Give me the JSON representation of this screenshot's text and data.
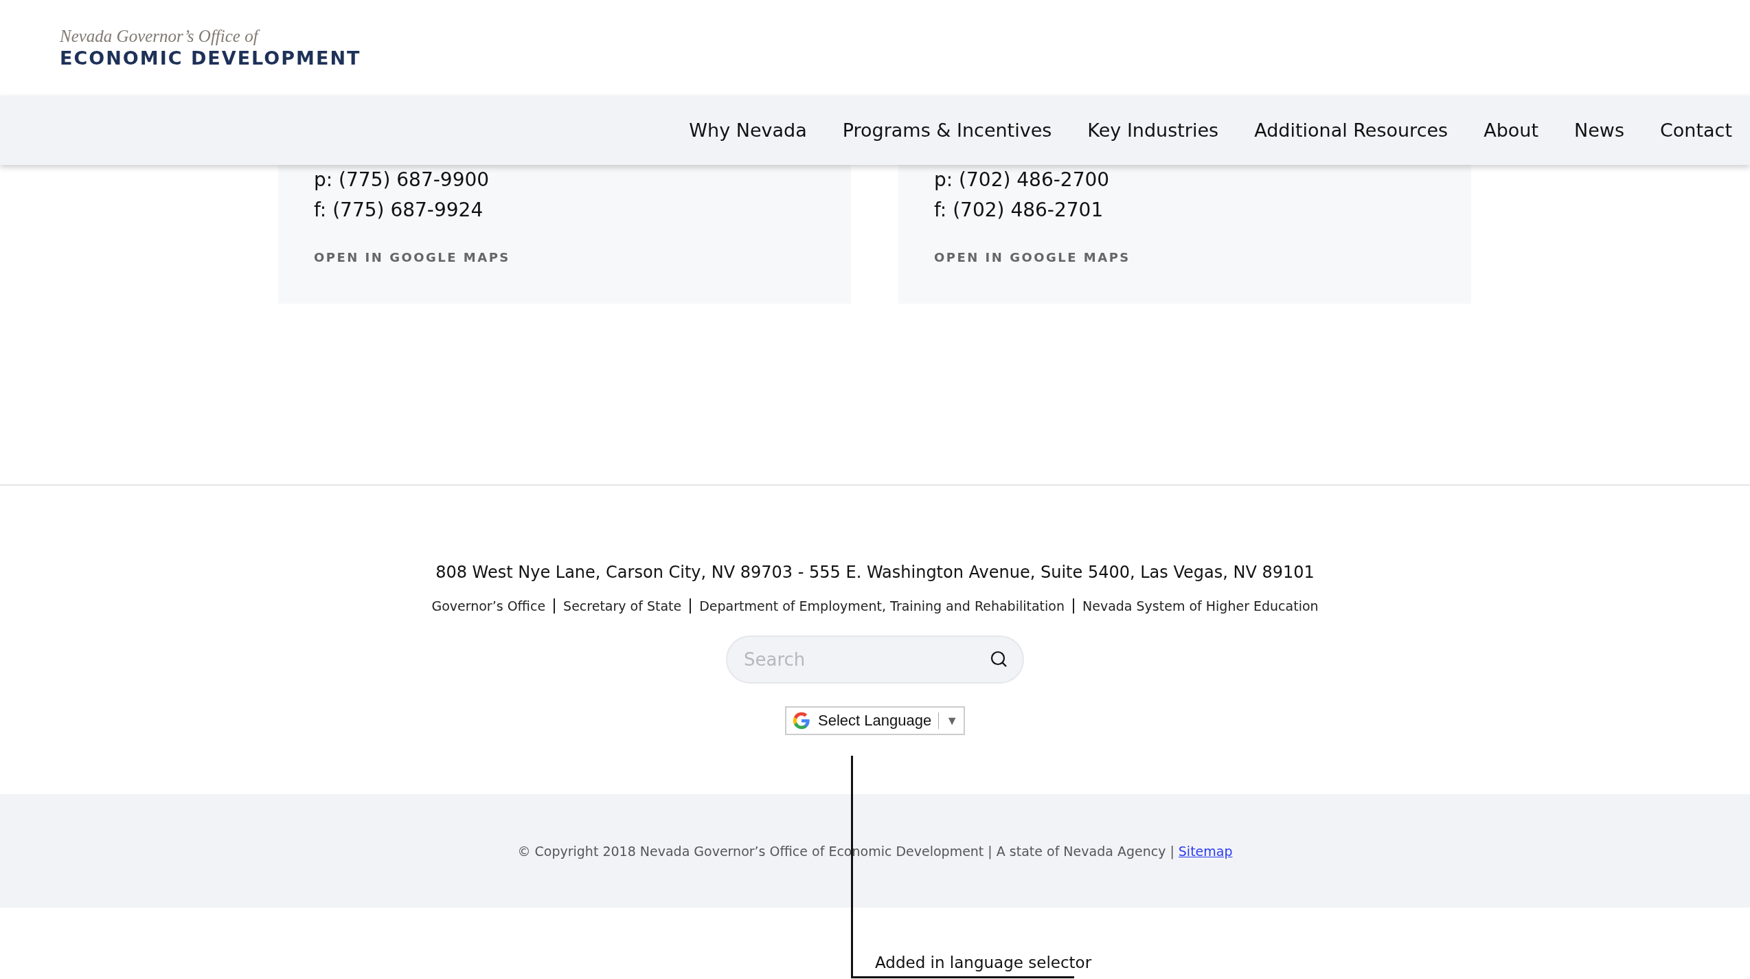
{
  "header": {
    "logo": {
      "tagline": "Nevada Governor’s Office of",
      "name": "ECONOMIC DEVELOPMENT"
    }
  },
  "nav": {
    "items": [
      {
        "label": "Why Nevada"
      },
      {
        "label": "Programs & Incentives"
      },
      {
        "label": "Key Industries"
      },
      {
        "label": "Additional Resources"
      },
      {
        "label": "About"
      },
      {
        "label": "News"
      },
      {
        "label": "Contact"
      }
    ]
  },
  "offices": [
    {
      "phone": "p: (775) 687-9900",
      "fax": "f: (775) 687-9924",
      "map_link": "OPEN IN GOOGLE MAPS"
    },
    {
      "phone": "p: (702) 486-2700",
      "fax": "f: (702) 486-2701",
      "map_link": "OPEN IN GOOGLE MAPS"
    }
  ],
  "footer": {
    "address": "808 West Nye Lane, Carson City, NV 89703 - 555 E. Washington Avenue, Suite 5400, Las Vegas, NV 89101",
    "links": [
      "Governor’s Office",
      "Secretary of State",
      "Department of Employment, Training and Rehabilitation",
      "Nevada System of Higher Education"
    ],
    "search": {
      "placeholder": "Search"
    },
    "language_selector": {
      "label": "Select Language",
      "arrow": "▼"
    },
    "copyright": {
      "text": "© Copyright 2018 Nevada Governor’s Office of Economic Development | A state of Nevada Agency |",
      "link": "Sitemap"
    }
  },
  "annotation": {
    "label": "Added in language selector"
  }
}
